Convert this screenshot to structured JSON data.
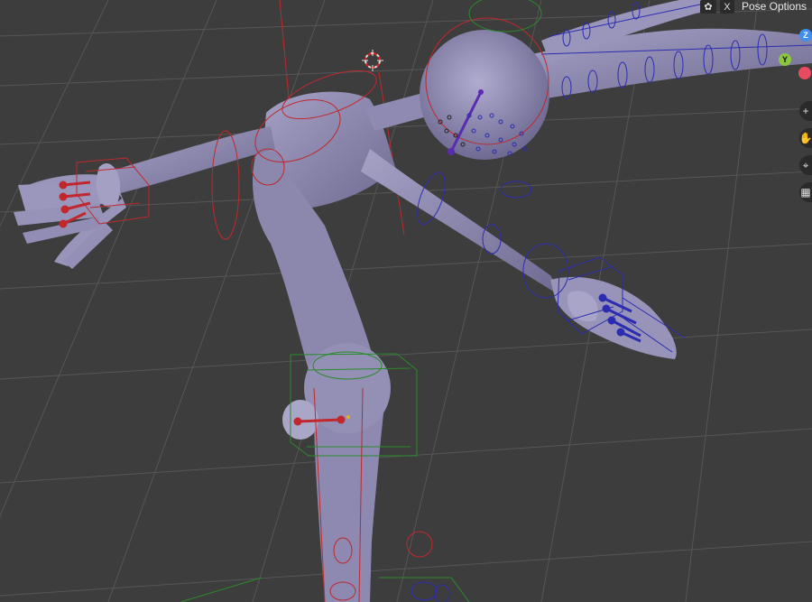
{
  "header": {
    "pose_icon": "pose-mode-icon",
    "close_label": "X",
    "pose_options_label": "Pose Options"
  },
  "gizmo": {
    "z_label": "Z",
    "y_label": "Y",
    "x_color": "#e84a5f",
    "y_color": "#8cc63f",
    "z_color": "#3f8ef0"
  },
  "tools": [
    {
      "name": "zoom-in-icon",
      "glyph": "+"
    },
    {
      "name": "hand-pan-icon",
      "glyph": "✋"
    },
    {
      "name": "camera-icon",
      "glyph": "⌖"
    },
    {
      "name": "grid-view-icon",
      "glyph": "▦"
    }
  ],
  "colors": {
    "background": "#3d3d3d",
    "grid": "#565656",
    "mesh": "#8f8bb0",
    "bone_left": "#c0282d",
    "bone_right": "#2c2cb0",
    "bone_center": "#2a8a2a"
  }
}
